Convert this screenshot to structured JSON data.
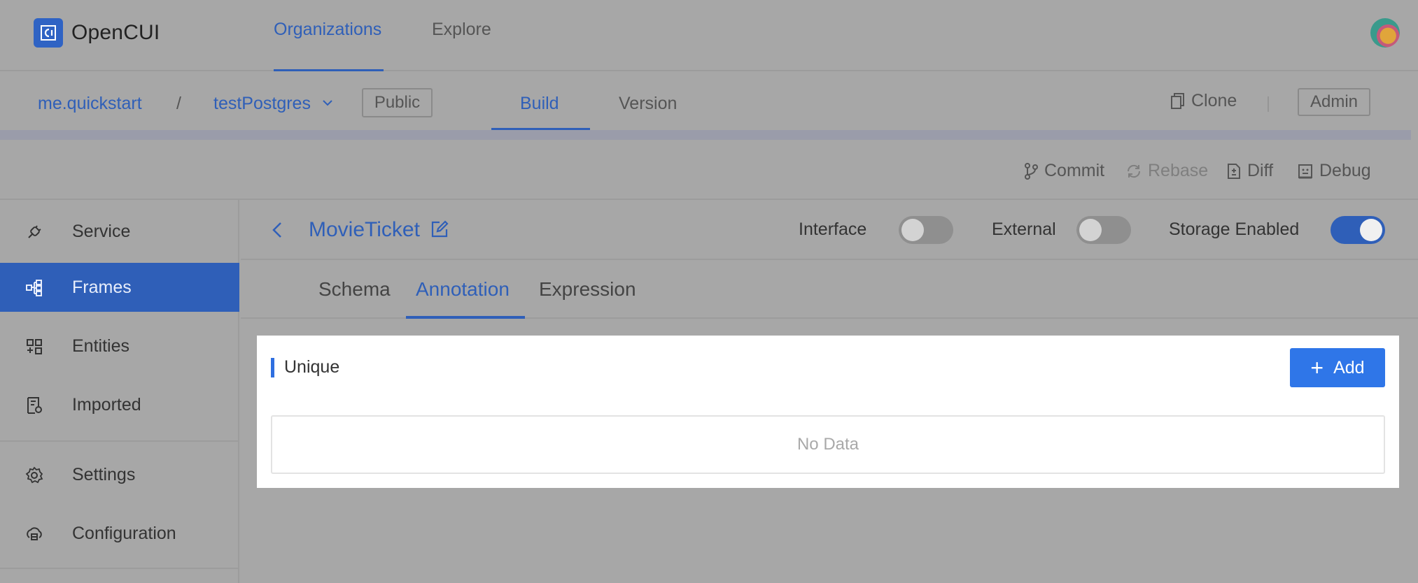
{
  "app": {
    "name": "OpenCUI"
  },
  "topnav": {
    "tabs": [
      {
        "label": "Organizations",
        "active": true
      },
      {
        "label": "Explore",
        "active": false
      }
    ]
  },
  "breadcrumb": {
    "org": "me.quickstart",
    "separator": "/",
    "project": "testPostgres",
    "visibility": "Public"
  },
  "subnav": {
    "tabs": [
      {
        "label": "Build",
        "active": true
      },
      {
        "label": "Version",
        "active": false
      }
    ],
    "clone_label": "Clone",
    "admin_label": "Admin"
  },
  "actions": {
    "commit": "Commit",
    "rebase": "Rebase",
    "diff": "Diff",
    "debug": "Debug"
  },
  "sidebar": {
    "items": [
      {
        "label": "Service",
        "icon": "service-icon",
        "active": false
      },
      {
        "label": "Frames",
        "icon": "frames-icon",
        "active": true
      },
      {
        "label": "Entities",
        "icon": "entities-icon",
        "active": false
      },
      {
        "label": "Imported",
        "icon": "imported-icon",
        "active": false
      },
      {
        "label": "Settings",
        "icon": "gear-icon",
        "active": false
      },
      {
        "label": "Configuration",
        "icon": "configuration-icon",
        "active": false
      }
    ]
  },
  "frame": {
    "title": "MovieTicket",
    "toggles": [
      {
        "label": "Interface",
        "on": false
      },
      {
        "label": "External",
        "on": false
      },
      {
        "label": "Storage Enabled",
        "on": true
      }
    ]
  },
  "content_tabs": [
    {
      "label": "Schema",
      "active": false
    },
    {
      "label": "Annotation",
      "active": true
    },
    {
      "label": "Expression",
      "active": false
    }
  ],
  "unique_panel": {
    "title": "Unique",
    "add_label": "Add",
    "empty_text": "No Data"
  },
  "colors": {
    "accent": "#2f5fb8",
    "button": "#2f76e8",
    "overlay": "#a7a7a7"
  }
}
